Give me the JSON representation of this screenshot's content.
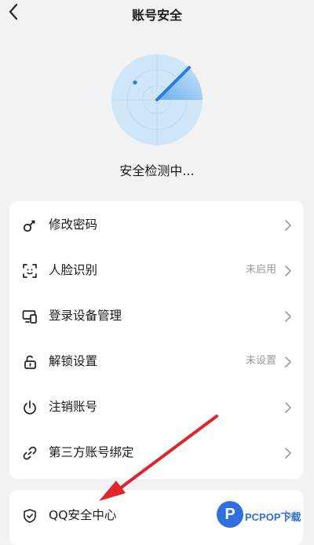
{
  "header": {
    "title": "账号安全",
    "back_icon": "chevron-left-icon"
  },
  "scan": {
    "status": "安全检测中..."
  },
  "menu": [
    {
      "label": "修改密码",
      "icon": "key-icon",
      "status": ""
    },
    {
      "label": "人脸识别",
      "icon": "face-scan-icon",
      "status": "未启用"
    },
    {
      "label": "登录设备管理",
      "icon": "devices-icon",
      "status": ""
    },
    {
      "label": "解锁设置",
      "icon": "unlock-icon",
      "status": "未设置"
    },
    {
      "label": "注销账号",
      "icon": "power-icon",
      "status": ""
    },
    {
      "label": "第三方账号绑定",
      "icon": "link-icon",
      "status": ""
    }
  ],
  "qq_security": {
    "label": "QQ安全中心",
    "icon": "shield-icon"
  },
  "watermark": {
    "text": "PCPOP下载",
    "logo_letter": "P"
  },
  "colors": {
    "accent": "#2a7be6",
    "background": "#f2f2f4",
    "annotation_arrow": "#e0262b"
  }
}
